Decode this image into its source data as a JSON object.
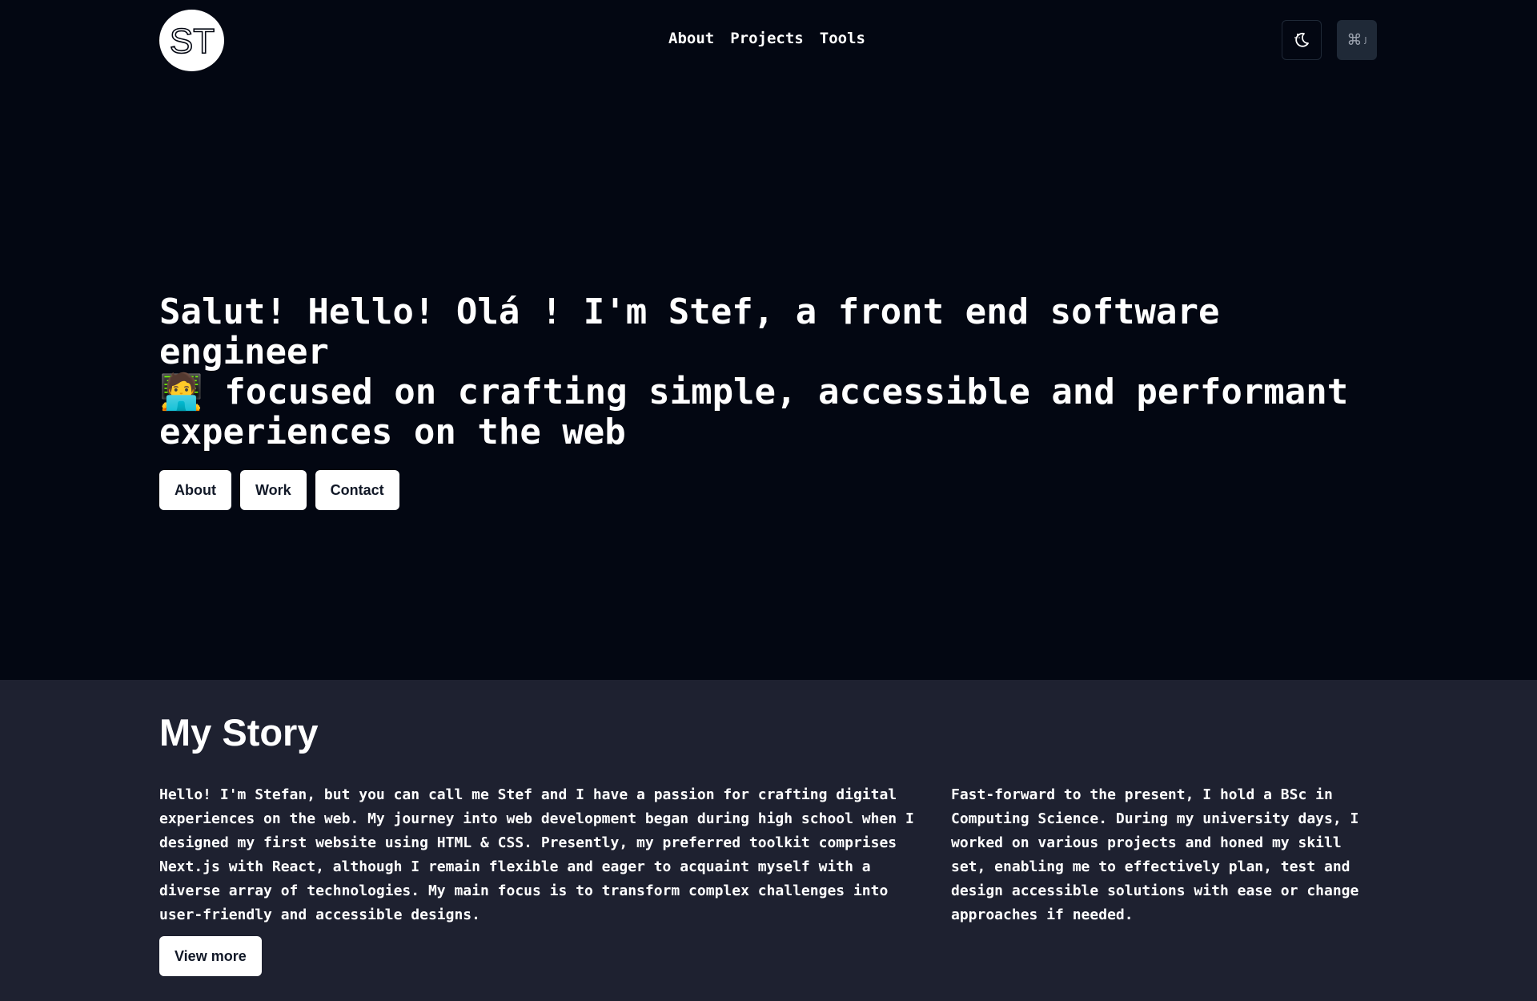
{
  "header": {
    "logo_text": "ST",
    "nav": [
      "About",
      "Projects",
      "Tools"
    ],
    "theme_icon": "moon-stars-icon",
    "command_key": "⌘",
    "command_shortcut": "J"
  },
  "hero": {
    "headline_part1": "Salut! Hello! Olá ! I'm Stef, a front end software engineer",
    "emoji": "🧑‍💻",
    "headline_part2": " focused on crafting simple, accessible and performant experiences on the web",
    "buttons": [
      "About",
      "Work",
      "Contact"
    ]
  },
  "story": {
    "title": "My Story",
    "paragraph_left": "Hello! I'm Stefan, but you can call me Stef and I have a passion for crafting digital experiences on the web. My journey into web development began during high school when I designed my first website using HTML & CSS. Presently, my preferred toolkit comprises Next.js with React, although I remain flexible and eager to acquaint myself with a diverse array of technologies. My main focus is to transform complex challenges into user-friendly and accessible designs.",
    "paragraph_right": "Fast-forward to the present, I hold a BSc in Computing Science. During my university days, I worked on various projects and honed my skill set, enabling me to effectively plan, test and design accessible solutions with ease or change approaches if needed.",
    "view_more": "View more"
  }
}
